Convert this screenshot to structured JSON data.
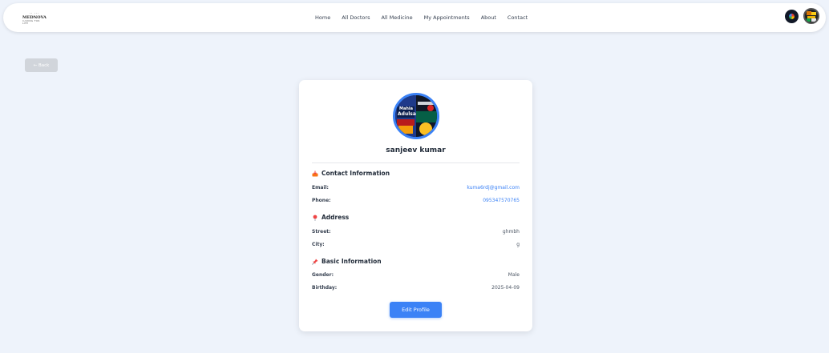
{
  "logo": {
    "marks": "ᐧᐧ ᐧᐧᐧ",
    "brand": "MEDNOVA",
    "tagline": "CARING FOR LIFE"
  },
  "nav": {
    "items": [
      {
        "label": "Home"
      },
      {
        "label": "All Doctors"
      },
      {
        "label": "All Medicine"
      },
      {
        "label": "My Appointments"
      },
      {
        "label": "About"
      },
      {
        "label": "Contact"
      }
    ],
    "right_icons": [
      "camera-icon",
      "user-avatar"
    ]
  },
  "back_button": {
    "label": "← Back"
  },
  "profile": {
    "avatar_text": {
      "line1": "Mahia",
      "line2": "Adulsa"
    },
    "name": "sanjeev kumar",
    "sections": {
      "contact": {
        "icon": "inbox-tray-icon",
        "title": "Contact Information",
        "email_label": "Email:",
        "email_value": "kuma6rdj@gmail.com",
        "phone_label": "Phone:",
        "phone_value": "095347570765"
      },
      "address": {
        "icon": "pin-icon",
        "title": "Address",
        "street_label": "Street:",
        "street_value": "ghmbh",
        "city_label": "City:",
        "city_value": "g"
      },
      "basic": {
        "icon": "pushpin-icon",
        "title": "Basic Information",
        "gender_label": "Gender:",
        "gender_value": "Male",
        "birthday_label": "Birthday:",
        "birthday_value": "2025-04-09"
      }
    },
    "edit_button": "Edit Profile"
  },
  "colors": {
    "background": "#eef3fb",
    "accent": "#3b82f6",
    "back_button": "#d1d5db"
  }
}
